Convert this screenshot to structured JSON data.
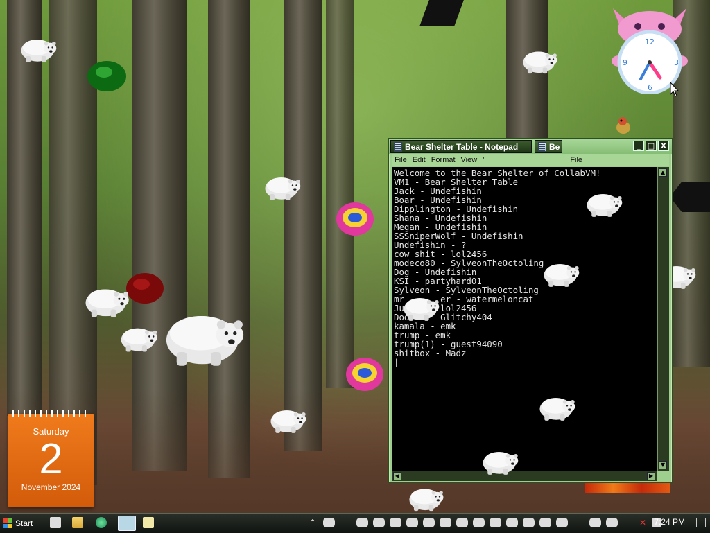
{
  "calendar": {
    "weekday": "Saturday",
    "day": "2",
    "month_year": "November 2024",
    "color": "#e96a12"
  },
  "clock": {
    "face": "pink-cat-clock",
    "hour": 4,
    "minute": 35
  },
  "notepad": {
    "title": "Bear Shelter Table - Notepad",
    "second_window_title_fragment": "Be",
    "menu": [
      "File",
      "Edit",
      "Format",
      "View",
      "'"
    ],
    "second_window_menu": "File",
    "lines": [
      "Welcome to the Bear Shelter of CollabVM!",
      "VM1 - Bear Shelter Table",
      "Jack - Undefishin",
      "Boar - Undefishin",
      "Dipplington - Undefishin",
      "Shana - Undefishin",
      "Megan - Undefishin",
      "SSSniperWolf - Undefishin",
      "Undefishin - ?",
      "cow shit - lol2456",
      "modeco80 - SylveonTheOctoling",
      "Dog - Undefishin",
      "KSI - partyhard01",
      "Sylveon - SylveonTheOctoling",
      "mr       er - watermeloncat",
      "Ju       lol2456",
      "Doo      Glitchy404",
      "kamala - emk",
      "trump - emk",
      "trump(1) - guest94090",
      "shitbox - Madz"
    ],
    "buttons": {
      "minimize": "_",
      "maximize": "□",
      "close": "X"
    }
  },
  "taskbar": {
    "start_label": "Start",
    "time": "7:24 PM",
    "quick_launch": [
      "bear-icon",
      "folder-icon",
      "browser-icon",
      "notepad-icon",
      "notepad-icon"
    ]
  },
  "colors": {
    "window_frame": "#9fcf8f",
    "title_active": "#2b4421",
    "taskbar": "#141914"
  }
}
